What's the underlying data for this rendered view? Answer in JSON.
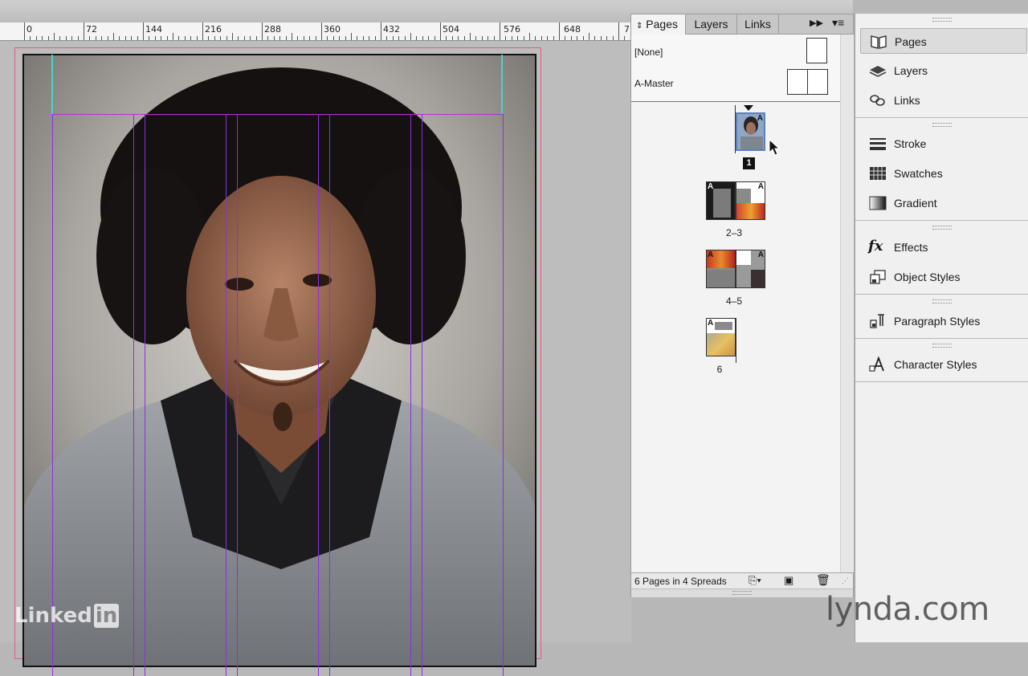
{
  "ruler": {
    "labels": [
      "0",
      "72",
      "144",
      "216",
      "288",
      "360",
      "432",
      "504",
      "576",
      "648",
      "7"
    ]
  },
  "pages_panel": {
    "tabs": [
      {
        "label": "Pages",
        "active": true
      },
      {
        "label": "Layers",
        "active": false
      },
      {
        "label": "Links",
        "active": false
      }
    ],
    "masters": [
      {
        "label": "[None]"
      },
      {
        "label": "A-Master"
      }
    ],
    "master_prefix": "A",
    "spreads": [
      {
        "label": "1",
        "selected": true
      },
      {
        "label": "2–3",
        "selected": false
      },
      {
        "label": "4–5",
        "selected": false
      },
      {
        "label": "6",
        "selected": false
      }
    ],
    "footer_text": "6 Pages in 4 Spreads"
  },
  "dock": {
    "groups": [
      [
        {
          "label": "Pages",
          "icon": "pages-icon",
          "selected": true
        },
        {
          "label": "Layers",
          "icon": "layers-icon",
          "selected": false
        },
        {
          "label": "Links",
          "icon": "links-icon",
          "selected": false
        }
      ],
      [
        {
          "label": "Stroke",
          "icon": "stroke-icon",
          "selected": false
        },
        {
          "label": "Swatches",
          "icon": "swatches-icon",
          "selected": false
        },
        {
          "label": "Gradient",
          "icon": "gradient-icon",
          "selected": false
        }
      ],
      [
        {
          "label": "Effects",
          "icon": "effects-icon",
          "selected": false
        },
        {
          "label": "Object Styles",
          "icon": "object-styles-icon",
          "selected": false
        }
      ],
      [
        {
          "label": "Paragraph Styles",
          "icon": "paragraph-styles-icon",
          "selected": false
        }
      ],
      [
        {
          "label": "Character Styles",
          "icon": "character-styles-icon",
          "selected": false
        }
      ]
    ]
  },
  "watermarks": {
    "left_a": "Linked",
    "left_b": "in",
    "right": "lynda.com"
  },
  "colors": {
    "guide": "#8e2fe0",
    "column_guide": "#46d3d3",
    "bleed": "#e35b7e"
  }
}
